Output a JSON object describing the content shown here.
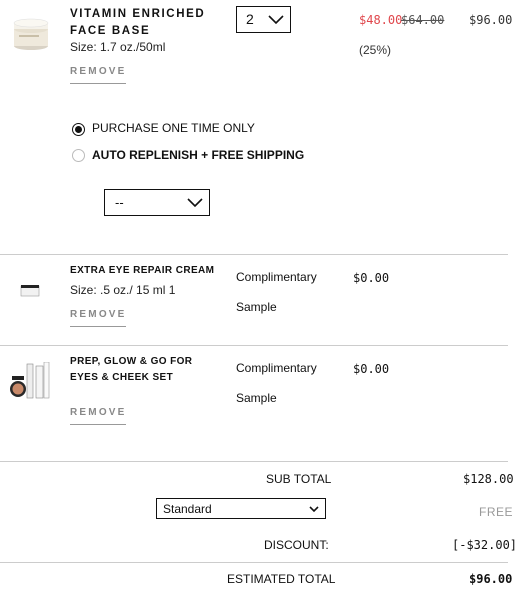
{
  "items": [
    {
      "name": "VITAMIN ENRICHED FACE BASE",
      "size": "Size: 1.7 oz./50ml",
      "remove": "REMOVE",
      "qty": "2",
      "sale_price": "$48.00",
      "orig_price": "$64.00",
      "discount": "(25%)",
      "total": "$96.00"
    },
    {
      "name": "EXTRA EYE REPAIR CREAM",
      "size": "Size: .5 oz./ 15 ml 1",
      "remove": "REMOVE",
      "note_line1": "Complimentary",
      "note_line2": "Sample",
      "price": "$0.00"
    },
    {
      "name": "PREP, GLOW & GO FOR EYES & CHEEK SET",
      "remove": "REMOVE",
      "note_line1": "Complimentary",
      "note_line2": "Sample",
      "price": "$0.00"
    }
  ],
  "purchase_options": {
    "one_time": "PURCHASE ONE TIME ONLY",
    "auto_replenish": "AUTO REPLENISH + FREE SHIPPING",
    "frequency_value": "--",
    "selected": "one_time"
  },
  "summary": {
    "subtotal_label": "SUB TOTAL",
    "subtotal_value": "$128.00",
    "shipping_method": "Standard",
    "shipping_value": "FREE",
    "discount_label": "DISCOUNT:",
    "discount_value": "[-$32.00]",
    "estimated_label": "ESTIMATED TOTAL",
    "estimated_value": "$96.00"
  },
  "colors": {
    "sale": "#e0474c",
    "muted": "#888888",
    "divider": "#cccccc"
  }
}
